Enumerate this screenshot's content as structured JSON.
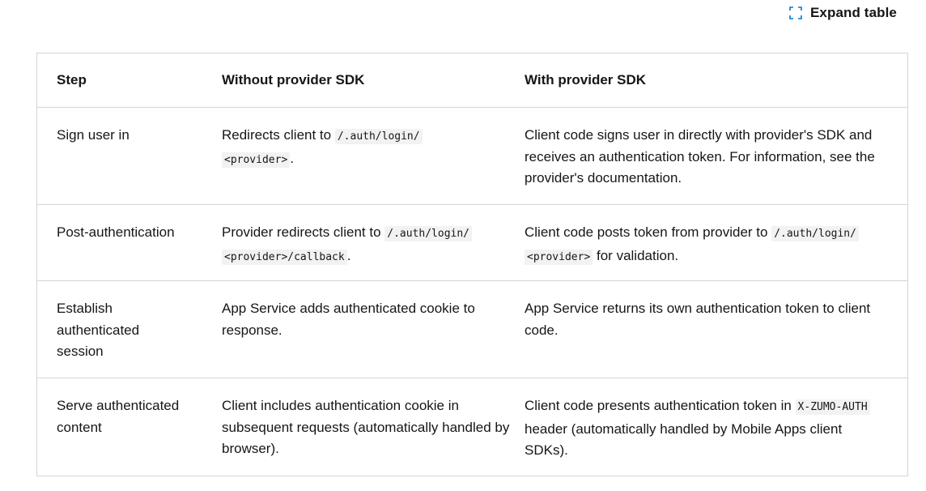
{
  "toolbar": {
    "expand_label": "Expand table",
    "expand_icon": "expand-icon",
    "accent_color": "#0078d4"
  },
  "table": {
    "headers": [
      "Step",
      "Without provider SDK",
      "With provider SDK"
    ],
    "rows": [
      {
        "step": "Sign user in",
        "without": {
          "pre": "Redirects client to ",
          "code1": "/.auth/login/",
          "code2": "<provider>",
          "post": "."
        },
        "with": {
          "text": "Client code signs user in directly with provider's SDK and receives an authentication token. For information, see the provider's documentation."
        }
      },
      {
        "step": "Post-authentication",
        "without": {
          "pre": "Provider redirects client to ",
          "code1": "/.auth/login/",
          "code2": "<provider>/callback",
          "post": "."
        },
        "with": {
          "pre": "Client code posts token from provider to ",
          "code1": "/.auth/login/",
          "code2": "<provider>",
          "post": " for validation."
        }
      },
      {
        "step": "Establish authenticated session",
        "without": {
          "text": "App Service adds authenticated cookie to response."
        },
        "with": {
          "text": "App Service returns its own authentication token to client code."
        }
      },
      {
        "step": "Serve authenticated content",
        "without": {
          "text": "Client includes authentication cookie in subsequent requests (automatically handled by browser)."
        },
        "with": {
          "pre": "Client code presents authentication token in ",
          "code1": "X-ZUMO-AUTH",
          "post": " header (automatically handled by Mobile Apps client SDKs)."
        }
      }
    ]
  }
}
